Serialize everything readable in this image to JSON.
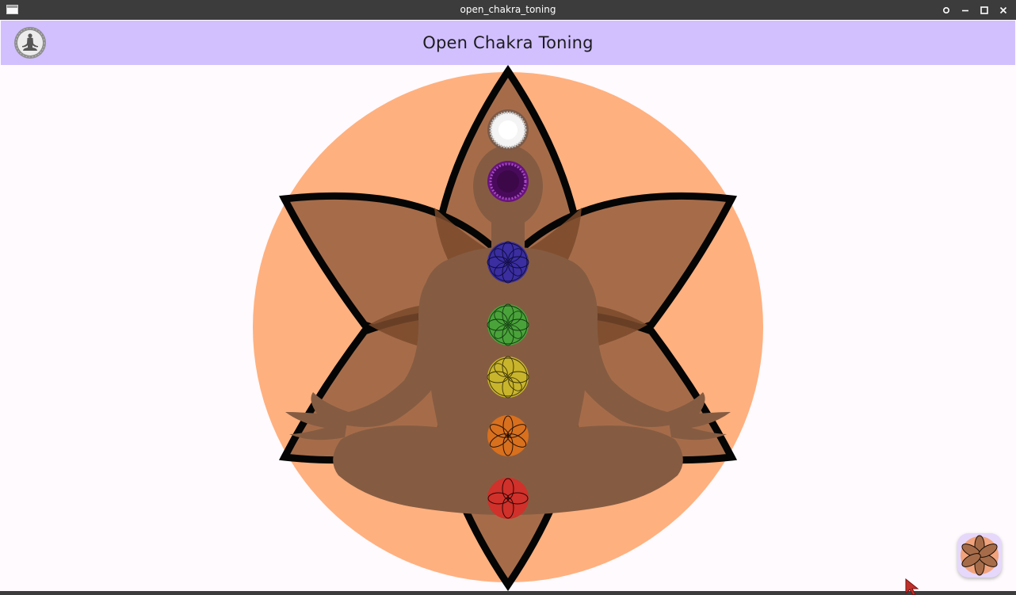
{
  "window": {
    "title": "open_chakra_toning",
    "controls": [
      "settings-icon",
      "minimize-icon",
      "maximize-icon",
      "close-icon"
    ]
  },
  "appbar": {
    "title": "Open Chakra Toning",
    "logo_icon": "meditation-logo-icon"
  },
  "illustration": {
    "background_circle_color": "#ffb07f",
    "petal_color": "#a66c4a",
    "petal_overlap_color": "#7a4a2c",
    "figure_color": "#855c42",
    "figure_icon": "meditating-figure-icon",
    "chakras": [
      {
        "name": "crown",
        "color": "#f2f2f2",
        "icon": "crown-chakra-icon"
      },
      {
        "name": "third-eye",
        "color": "#4a0a5c",
        "icon": "third-eye-chakra-icon"
      },
      {
        "name": "throat",
        "color": "#3a2ea0",
        "icon": "throat-chakra-icon"
      },
      {
        "name": "heart",
        "color": "#4aa33a",
        "icon": "heart-chakra-icon"
      },
      {
        "name": "solar-plexus",
        "color": "#c9b52c",
        "icon": "solar-plexus-chakra-icon"
      },
      {
        "name": "sacral",
        "color": "#d8701e",
        "icon": "sacral-chakra-icon"
      },
      {
        "name": "root",
        "color": "#d0312a",
        "icon": "root-chakra-icon"
      }
    ]
  },
  "fab": {
    "icon": "lotus-flower-icon"
  },
  "colors": {
    "titlebar": "#3c3c3c",
    "appbar": "#d1c0fd",
    "background": "#fefafd"
  }
}
